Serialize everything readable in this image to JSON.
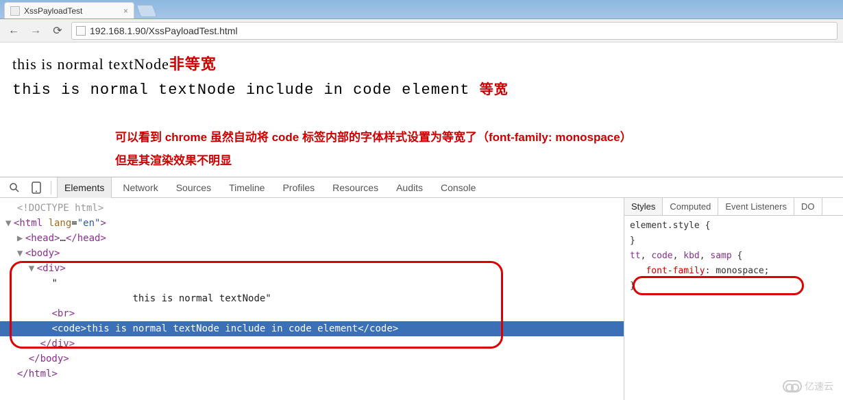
{
  "browser": {
    "tab_title": "XssPayloadTest",
    "url": "192.168.1.90/XssPayloadTest.html"
  },
  "page": {
    "line1": "this is normal textNode",
    "annot1": "非等宽",
    "line2": "this is normal textNode include in code element",
    "annot2": "等宽",
    "big_annot_l1": "可以看到 chrome 虽然自动将 code 标签内部的字体样式设置为等宽了（font-family: monospace）",
    "big_annot_l2": "但是其渲染效果不明显"
  },
  "devtools": {
    "tabs": [
      "Elements",
      "Network",
      "Sources",
      "Timeline",
      "Profiles",
      "Resources",
      "Audits",
      "Console"
    ],
    "active_tab": "Elements",
    "dom": {
      "doctype": "<!DOCTYPE html>",
      "html_open": "<html lang=\"en\">",
      "head": "<head>…</head>",
      "body_open": "<body>",
      "div_open": "<div>",
      "text_quote_open": "\"",
      "text_content": "            this is normal textNode\"",
      "br": "<br>",
      "code_line": "<code>this is normal textNode include in code element</code>",
      "div_close": "</div>",
      "body_close": "</body>",
      "html_close": "</html>"
    },
    "styles": {
      "tabs": [
        "Styles",
        "Computed",
        "Event Listeners",
        "DO"
      ],
      "active_tab": "Styles",
      "rule1_sel": "element.style {",
      "rule1_close": "}",
      "rule2_sel": "tt, code, kbd, samp {",
      "rule2_prop": "font-family",
      "rule2_val": "monospace;",
      "rule2_close": "}"
    }
  },
  "watermark": "亿速云"
}
